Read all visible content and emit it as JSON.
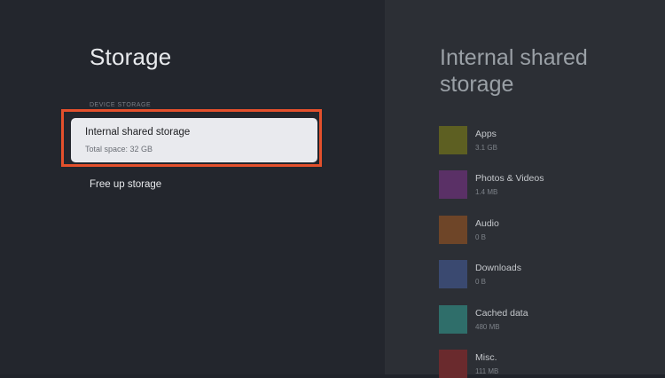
{
  "page": {
    "title": "Storage",
    "section_label": "DEVICE STORAGE"
  },
  "device_storage": {
    "item_title": "Internal shared storage",
    "item_subtitle": "Total space: 32 GB",
    "free_up_label": "Free up storage"
  },
  "detail": {
    "title": "Internal shared storage",
    "categories": [
      {
        "label": "Apps",
        "size": "3.1 GB",
        "color": "#5d5f22"
      },
      {
        "label": "Photos & Videos",
        "size": "1.4 MB",
        "color": "#5a3066"
      },
      {
        "label": "Audio",
        "size": "0 B",
        "color": "#6e4528"
      },
      {
        "label": "Downloads",
        "size": "0 B",
        "color": "#3a4970"
      },
      {
        "label": "Cached data",
        "size": "480 MB",
        "color": "#2f6e6a"
      },
      {
        "label": "Misc.",
        "size": "111 MB",
        "color": "#6a2a2d"
      }
    ]
  },
  "colors": {
    "highlight_border": "#e4502c",
    "card_background": "#e9eaee"
  }
}
